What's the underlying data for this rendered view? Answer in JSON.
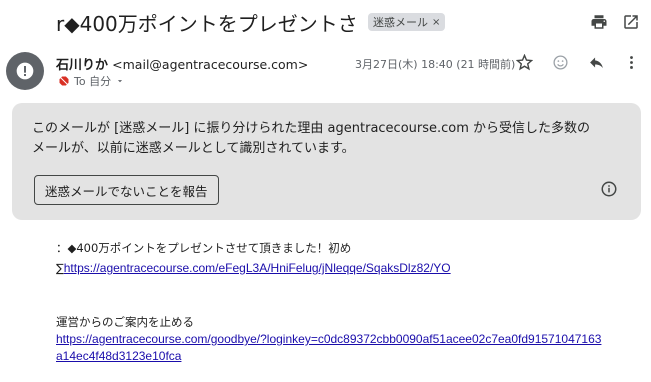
{
  "subject": {
    "text": "r◆400万ポイントをプレゼントさ",
    "label_chip": "迷惑メール",
    "label_close": "×"
  },
  "toolbar_icons": [
    "print-icon",
    "open-in-new-window-icon"
  ],
  "sender": {
    "name": "石川りか",
    "email": "<mail@agentracecourse.com>",
    "to_label": "To 自分",
    "date": "3月27日(木) 18:40 (21 時間前)"
  },
  "message_actions": [
    "star-icon",
    "emoji-icon",
    "reply-icon",
    "more-vert-icon"
  ],
  "spam_notice": {
    "text": "このメールが [迷惑メール] に振り分けられた理由 agentracecourse.com から受信した多数のメールが、以前に迷惑メールとして識別されています。",
    "report_button": "迷惑メールでないことを報告"
  },
  "body": {
    "line1": "：◆400万ポイントをプレゼントさせて頂きました！初め",
    "link1_prefix": "∑",
    "link1": "https://agentracecourse.com/eFegL3A/HniFelug/jNleqqe/SqaksDlz82/YO",
    "stop_text": "運営からのご案内を止める",
    "link2_line1": "https://agentracecourse.com/goodbye/?loginkey=c0dc89372cbb0090af51acee02c7ea0fd91571047163",
    "link2_line2": "a14ec4f48d3123e10fca"
  },
  "colors": {
    "link": "#1a0dab",
    "spam_box_bg": "#e3e3e3",
    "avatar_bg": "#5f6368",
    "spam_icon": "#d93025"
  }
}
